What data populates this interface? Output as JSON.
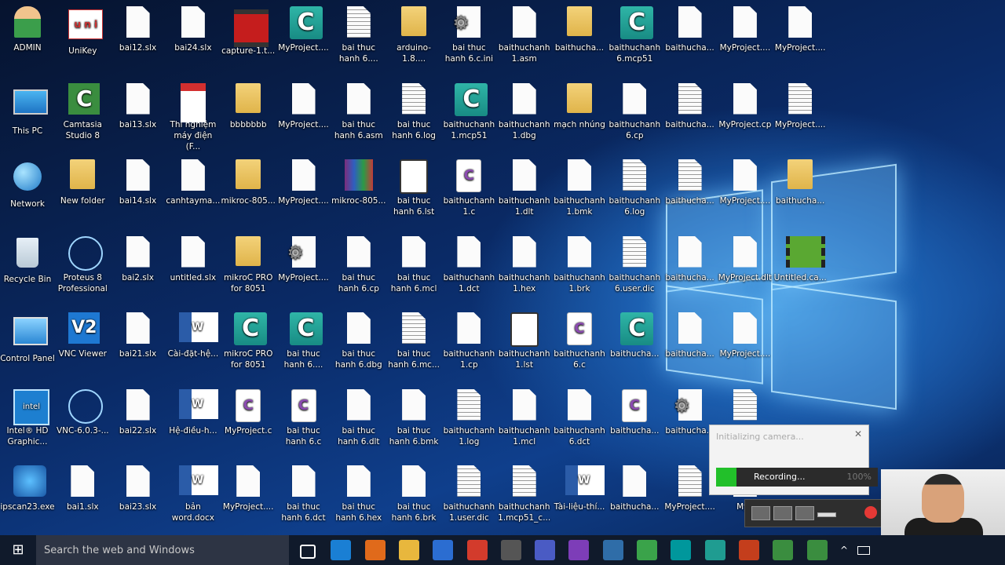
{
  "desktop": {
    "icons": [
      {
        "label": "ADMIN",
        "type": "avatar"
      },
      {
        "label": "UniKey",
        "type": "unikey"
      },
      {
        "label": "bai12.slx",
        "type": "file"
      },
      {
        "label": "bai24.slx",
        "type": "file"
      },
      {
        "label": "capture-1.t...",
        "type": "capture"
      },
      {
        "label": "MyProject....",
        "type": "mc"
      },
      {
        "label": "bai thuc hanh 6....",
        "type": "text"
      },
      {
        "label": "arduino-1.8....",
        "type": "folder"
      },
      {
        "label": "bai thuc hanh 6.c.ini",
        "type": "gear"
      },
      {
        "label": "baithuchanh 1.asm",
        "type": "file"
      },
      {
        "label": "baithucha...",
        "type": "folder"
      },
      {
        "label": "baithuchanh 6.mcp51",
        "type": "mc"
      },
      {
        "label": "baithucha...",
        "type": "file"
      },
      {
        "label": "MyProject....",
        "type": "file"
      },
      {
        "label": "MyProject....",
        "type": "file"
      },
      {
        "label": "This PC",
        "type": "pc"
      },
      {
        "label": "Camtasia Studio 8",
        "type": "camt"
      },
      {
        "label": "bai13.slx",
        "type": "file"
      },
      {
        "label": "Thí nghiệm máy điện (F...",
        "type": "pdf"
      },
      {
        "label": "bbbbbbb",
        "type": "folder"
      },
      {
        "label": "MyProject....",
        "type": "file"
      },
      {
        "label": "bai thuc hanh 6.asm",
        "type": "file"
      },
      {
        "label": "bai thuc hanh 6.log",
        "type": "text"
      },
      {
        "label": "baithuchanh 1.mcp51",
        "type": "mc"
      },
      {
        "label": "baithuchanh 1.dbg",
        "type": "file"
      },
      {
        "label": "mạch nhúng",
        "type": "folder"
      },
      {
        "label": "baithuchanh 6.cp",
        "type": "file"
      },
      {
        "label": "baithucha...",
        "type": "text"
      },
      {
        "label": "MyProject.cp",
        "type": "file"
      },
      {
        "label": "MyProject....",
        "type": "text"
      },
      {
        "label": "Network",
        "type": "net"
      },
      {
        "label": "New folder",
        "type": "folder"
      },
      {
        "label": "bai14.slx",
        "type": "file"
      },
      {
        "label": "canhtayma...",
        "type": "file"
      },
      {
        "label": "mikroc-805...",
        "type": "folder"
      },
      {
        "label": "MyProject....",
        "type": "file"
      },
      {
        "label": "mikroc-805...",
        "type": "rar"
      },
      {
        "label": "bai thuc hanh 6.lst",
        "type": "lst"
      },
      {
        "label": "baithuchanh 1.c",
        "type": "c"
      },
      {
        "label": "baithuchanh 1.dlt",
        "type": "file"
      },
      {
        "label": "baithuchanh 1.bmk",
        "type": "file"
      },
      {
        "label": "baithuchanh 6.log",
        "type": "text"
      },
      {
        "label": "baithucha...",
        "type": "text"
      },
      {
        "label": "MyProject....",
        "type": "file"
      },
      {
        "label": "baithucha...",
        "type": "folder"
      },
      {
        "label": "Recycle Bin",
        "type": "bin"
      },
      {
        "label": "Proteus 8 Professional",
        "type": "proteus"
      },
      {
        "label": "bai2.slx",
        "type": "file"
      },
      {
        "label": "untitled.slx",
        "type": "file"
      },
      {
        "label": "mikroC PRO for 8051",
        "type": "folder"
      },
      {
        "label": "MyProject....",
        "type": "gear"
      },
      {
        "label": "bai thuc hanh 6.cp",
        "type": "file"
      },
      {
        "label": "bai thuc hanh 6.mcl",
        "type": "file"
      },
      {
        "label": "baithuchanh 1.dct",
        "type": "file"
      },
      {
        "label": "baithuchanh 1.hex",
        "type": "file"
      },
      {
        "label": "baithuchanh 1.brk",
        "type": "file"
      },
      {
        "label": "baithuchanh 6.user.dic",
        "type": "text"
      },
      {
        "label": "baithucha...",
        "type": "file"
      },
      {
        "label": "MyProject.dlt",
        "type": "file"
      },
      {
        "label": "Untitled.ca...",
        "type": "video"
      },
      {
        "label": "Control Panel",
        "type": "cp"
      },
      {
        "label": "VNC Viewer",
        "type": "vnc"
      },
      {
        "label": "bai21.slx",
        "type": "file"
      },
      {
        "label": "Cài-đặt-hệ...",
        "type": "word"
      },
      {
        "label": "mikroC PRO for 8051",
        "type": "mc"
      },
      {
        "label": "bai thuc hanh 6....",
        "type": "mc"
      },
      {
        "label": "bai thuc hanh 6.dbg",
        "type": "file"
      },
      {
        "label": "bai thuc hanh 6.mc...",
        "type": "text"
      },
      {
        "label": "baithuchanh 1.cp",
        "type": "file"
      },
      {
        "label": "baithuchanh 1.lst",
        "type": "lst"
      },
      {
        "label": "baithuchanh 6.c",
        "type": "c"
      },
      {
        "label": "baithucha...",
        "type": "mc"
      },
      {
        "label": "baithucha...",
        "type": "file"
      },
      {
        "label": "MyProject....",
        "type": "file"
      },
      {
        "label": "Intel® HD Graphic...",
        "type": "intel"
      },
      {
        "label": "VNC-6.0.3-...",
        "type": "proteus"
      },
      {
        "label": "bai22.slx",
        "type": "file"
      },
      {
        "label": "Hệ-điều-h...",
        "type": "word"
      },
      {
        "label": "MyProject.c",
        "type": "c"
      },
      {
        "label": "bai thuc hanh 6.c",
        "type": "c"
      },
      {
        "label": "bai thuc hanh 6.dlt",
        "type": "file"
      },
      {
        "label": "bai thuc hanh 6.bmk",
        "type": "file"
      },
      {
        "label": "baithuchanh 1.log",
        "type": "text"
      },
      {
        "label": "baithuchanh 1.mcl",
        "type": "file"
      },
      {
        "label": "baithuchanh 6.dct",
        "type": "file"
      },
      {
        "label": "baithucha...",
        "type": "c"
      },
      {
        "label": "baithucha...",
        "type": "gear"
      },
      {
        "label": "",
        "type": "text"
      },
      {
        "label": "ipscan23.exe",
        "type": "ipscan"
      },
      {
        "label": "bai1.slx",
        "type": "file"
      },
      {
        "label": "bai23.slx",
        "type": "file"
      },
      {
        "label": "bản word.docx",
        "type": "word"
      },
      {
        "label": "MyProject....",
        "type": "file"
      },
      {
        "label": "bai thuc hanh 6.dct",
        "type": "file"
      },
      {
        "label": "bai thuc hanh 6.hex",
        "type": "file"
      },
      {
        "label": "bai thuc hanh 6.brk",
        "type": "file"
      },
      {
        "label": "baithuchanh 1.user.dic",
        "type": "text"
      },
      {
        "label": "baithuchanh 1.mcp51_c...",
        "type": "text"
      },
      {
        "label": "Tài-liệu-thí...",
        "type": "word"
      },
      {
        "label": "baithucha...",
        "type": "file"
      },
      {
        "label": "MyProject....",
        "type": "text"
      },
      {
        "label": "MyP",
        "type": "file"
      }
    ]
  },
  "camera_popup": {
    "title": "Initializing camera...",
    "close": "✕"
  },
  "recorder": {
    "status": "Recording...",
    "percent": "100%"
  },
  "taskbar": {
    "start_icon": "⊞",
    "search_placeholder": "Search the web and Windows",
    "apps": [
      "task-view",
      "edge",
      "matlab",
      "file-explorer",
      "store",
      "chrome",
      "unity",
      "word-vsto",
      "visual-studio",
      "proteus",
      "green-app",
      "arduino",
      "mikroc",
      "powerpoint",
      "camtasia",
      "camtasia-recorder"
    ],
    "tray_chevron": "^"
  }
}
